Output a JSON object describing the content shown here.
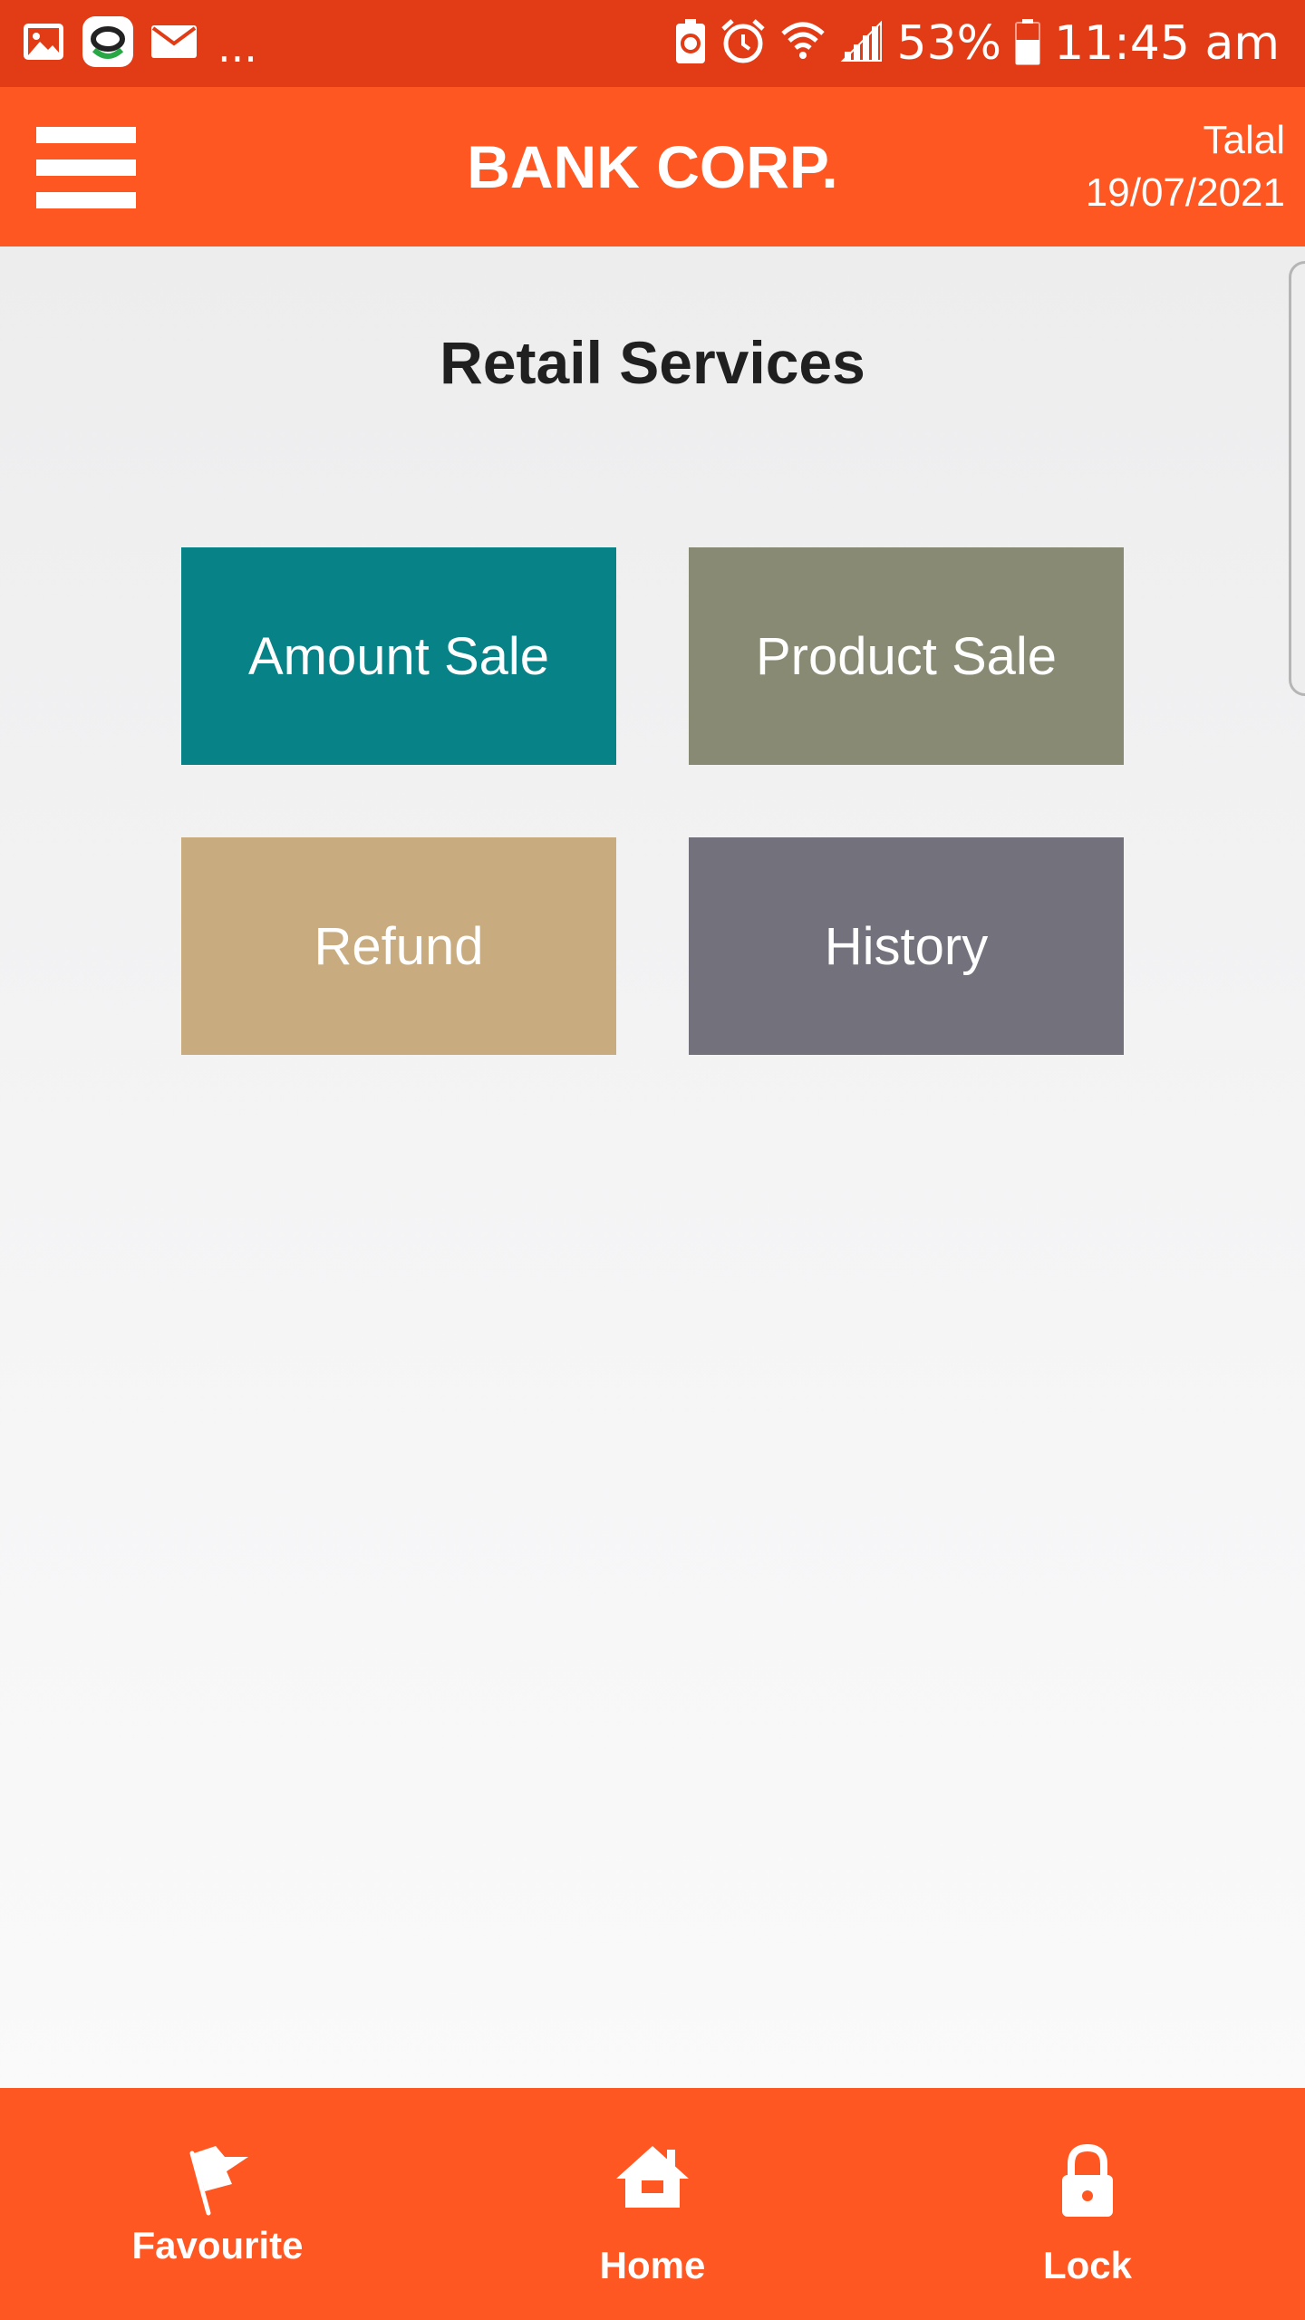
{
  "status_bar": {
    "overflow_indicator": "...",
    "battery_percent": "53%",
    "time": "11:45 am",
    "notification_icons": [
      "gallery-icon",
      "app-icon",
      "mail-icon"
    ],
    "system_icons": [
      "battery-saver-icon",
      "alarm-icon",
      "wifi-icon",
      "signal-icon",
      "battery-icon"
    ],
    "background": "#e23c17"
  },
  "header": {
    "title": "BANK CORP.",
    "user_name": "Talal",
    "date": "19/07/2021",
    "menu_icon": "hamburger-menu-icon",
    "background": "#ff5722"
  },
  "main": {
    "title": "Retail Services",
    "tiles": [
      {
        "label": "Amount Sale",
        "color": "#078287"
      },
      {
        "label": "Product Sale",
        "color": "#888a73"
      },
      {
        "label": "Refund",
        "color": "#c8ac80"
      },
      {
        "label": "History",
        "color": "#73717b"
      }
    ]
  },
  "bottom_nav": {
    "items": [
      {
        "label": "Favourite",
        "icon": "flag-icon"
      },
      {
        "label": "Home",
        "icon": "home-icon"
      },
      {
        "label": "Lock",
        "icon": "lock-icon"
      }
    ],
    "background": "#ff5722"
  }
}
